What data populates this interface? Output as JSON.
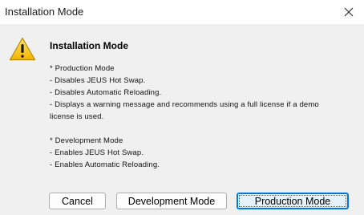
{
  "window": {
    "title": "Installation Mode",
    "close_icon": "close-icon"
  },
  "dialog": {
    "icon": "warning-icon",
    "heading": "Installation Mode",
    "lines": [
      "* Production Mode",
      "- Disables JEUS Hot Swap.",
      "- Disables Automatic Reloading.",
      "- Displays a warning message and recommends using a full license if a demo",
      "license is used.",
      "",
      "* Development Mode",
      "- Enables JEUS Hot Swap.",
      "- Enables Automatic Reloading."
    ]
  },
  "buttons": {
    "cancel": "Cancel",
    "development": "Development Mode",
    "production": "Production Mode"
  },
  "colors": {
    "warning_fill": "#f5c518",
    "focus_border": "#0078d7"
  }
}
